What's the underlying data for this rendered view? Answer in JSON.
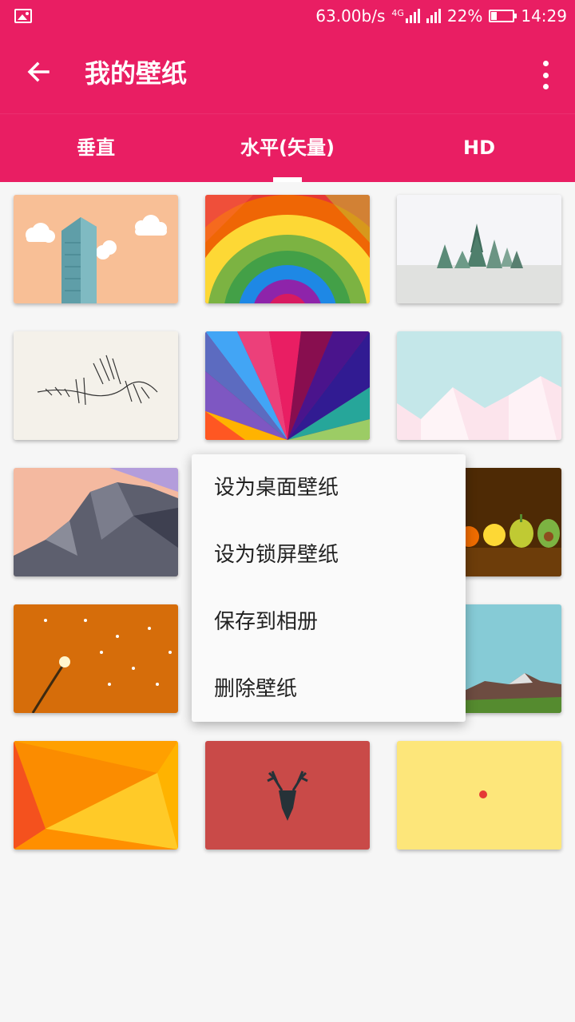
{
  "status_bar": {
    "speed": "63.00b/s",
    "network": "4G",
    "battery_level": "22%",
    "battery_fraction": 0.22,
    "time": "14:29"
  },
  "app_bar": {
    "title": "我的壁纸",
    "back_icon": "arrow-left-icon",
    "more_icon": "more-vert-icon"
  },
  "tabs": [
    {
      "label": "垂直",
      "active": false
    },
    {
      "label": "水平(矢量)",
      "active": true
    },
    {
      "label": "HD",
      "active": false
    }
  ],
  "context_menu": {
    "items": [
      {
        "label": "设为桌面壁纸"
      },
      {
        "label": "设为锁屏壁纸"
      },
      {
        "label": "保存到相册"
      },
      {
        "label": "删除壁纸"
      }
    ]
  },
  "colors": {
    "primary": "#e91e63",
    "background": "#f6f6f6",
    "menu_bg": "#fafafa"
  }
}
